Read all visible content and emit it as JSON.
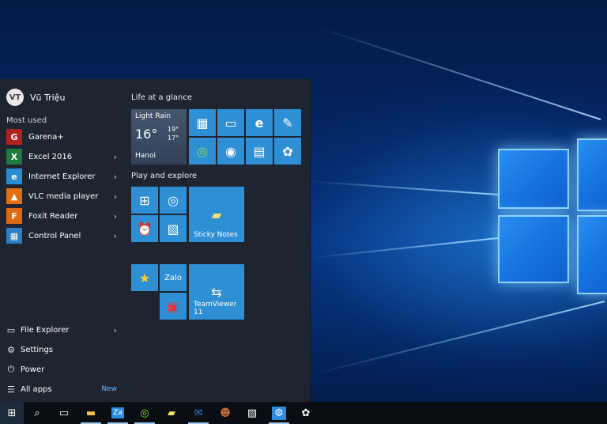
{
  "user": {
    "name": "Vũ Triệu",
    "avatar_text": "VT"
  },
  "most_used_label": "Most used",
  "apps": [
    {
      "label": "Garena+",
      "icon": "garena-icon",
      "color": "#b11f1f",
      "glyph": "G",
      "has_submenu": false
    },
    {
      "label": "Excel 2016",
      "icon": "excel-icon",
      "color": "#1f7a3f",
      "glyph": "X",
      "has_submenu": true
    },
    {
      "label": "Internet Explorer",
      "icon": "internet-explorer-icon",
      "color": "#2b8ccf",
      "glyph": "e",
      "has_submenu": true
    },
    {
      "label": "VLC media player",
      "icon": "vlc-icon",
      "color": "#e0700f",
      "glyph": "▲",
      "has_submenu": true
    },
    {
      "label": "Foxit Reader",
      "icon": "foxit-icon",
      "color": "#e06a10",
      "glyph": "F",
      "has_submenu": true
    },
    {
      "label": "Control Panel",
      "icon": "control-panel-icon",
      "color": "#2d7fc1",
      "glyph": "▦",
      "has_submenu": true
    }
  ],
  "system": {
    "file_explorer": "File Explorer",
    "settings": "Settings",
    "power": "Power",
    "all_apps": "All apps",
    "new_badge": "New"
  },
  "groups": {
    "life": "Life at a glance",
    "play": "Play and explore"
  },
  "weather": {
    "condition": "Light Rain",
    "temp": "16°",
    "high": "19°",
    "low": "17°",
    "city": "Hanoi"
  },
  "tiles": {
    "sticky_notes": "Sticky Notes",
    "teamviewer": "TeamViewer 11"
  },
  "colors": {
    "tile": "#2f8fd4",
    "menu_bg": "#1e2530",
    "taskbar_bg": "#0a0d12"
  }
}
